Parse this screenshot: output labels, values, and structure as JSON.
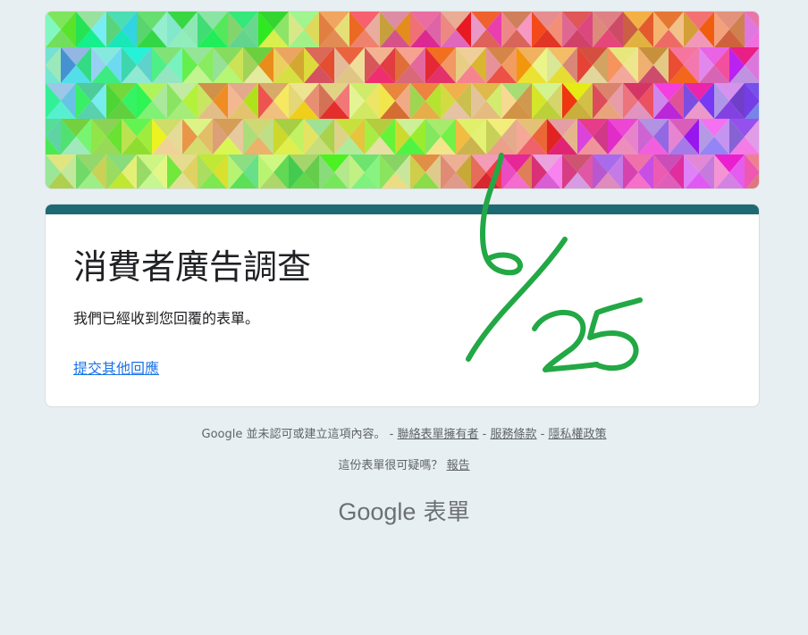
{
  "form": {
    "title": "消費者廣告調查",
    "message": "我們已經收到您回覆的表單。",
    "submit_another": "提交其他回應",
    "accent_color": "#1e6a73"
  },
  "footer": {
    "disclaimer": "Google 並未認可或建立這項內容。 -",
    "contact_owner": "聯絡表單擁有者",
    "sep1": "-",
    "terms": "服務條款",
    "sep2": "-",
    "privacy": "隱私權政策",
    "suspicious": "這份表單很可疑嗎？",
    "report": "報告"
  },
  "brand": {
    "google": "Google",
    "forms": "表單"
  },
  "annotation": {
    "text": "6/25",
    "color": "#22a845"
  }
}
